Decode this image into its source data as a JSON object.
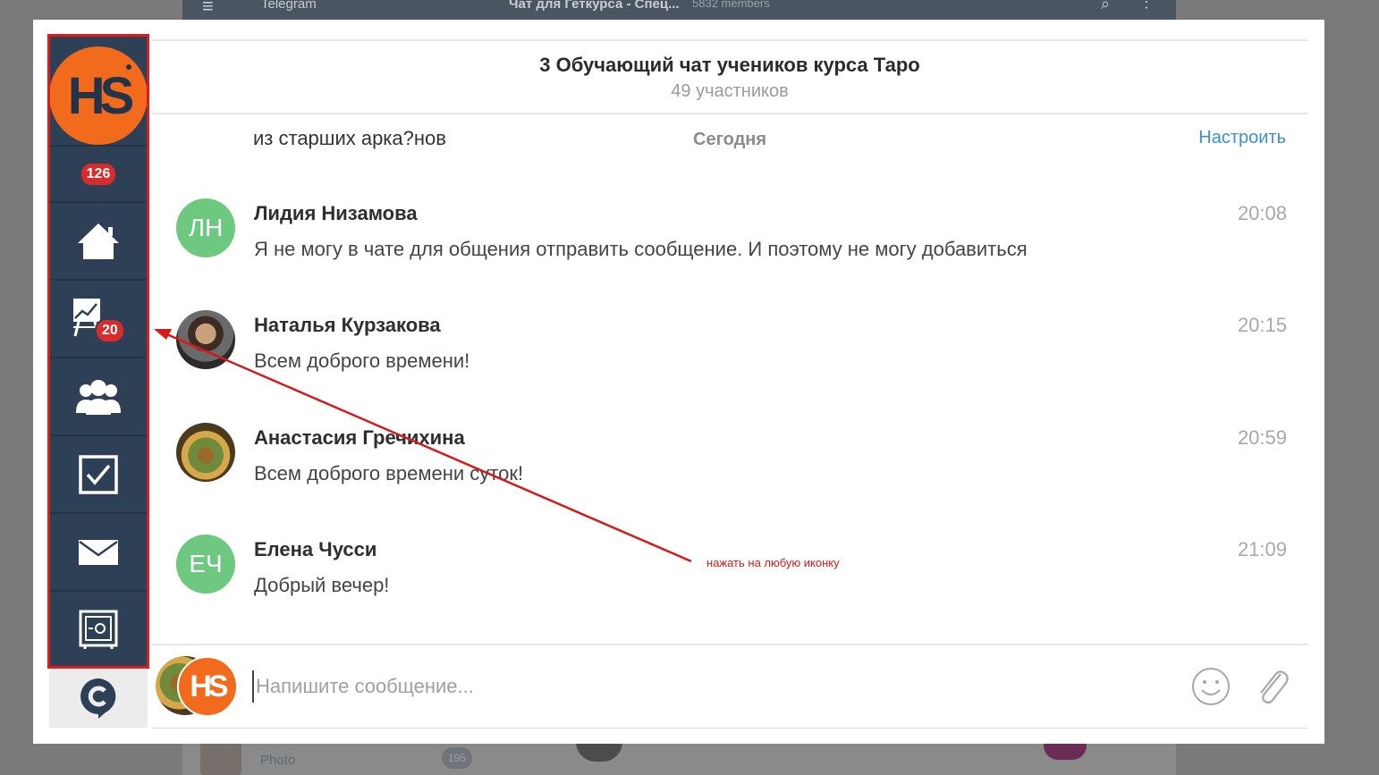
{
  "background_window": {
    "app_name": "Telegram",
    "chat_title": "Чат для Геткурса - Спец...",
    "members": "5832 members",
    "bottom_label": "Photo",
    "bottom_badge": "195"
  },
  "sidebar": {
    "logo_text": "HS",
    "notifications_badge": "126",
    "chart_badge": "20",
    "items": [
      {
        "name": "home"
      },
      {
        "name": "chart"
      },
      {
        "name": "people"
      },
      {
        "name": "tasks"
      },
      {
        "name": "mail"
      },
      {
        "name": "safe"
      }
    ],
    "bottom_icon": "chat-app-icon"
  },
  "chat": {
    "title": "3 Обучающий чат учеников курса Таро",
    "subtitle": "49 участников",
    "partial_message": "из старших арка?нов",
    "day_separator": "Сегодня",
    "settings_link": "Настроить",
    "messages": [
      {
        "initials": "ЛН",
        "name": "Лидия Низамова",
        "text": "Я не могу в чате для общения отправить сообщение. И поэтому не могу добавиться",
        "time": "20:08"
      },
      {
        "initials": "",
        "name": "Наталья Курзакова",
        "text": "Всем доброго времени!",
        "time": "20:15"
      },
      {
        "initials": "",
        "name": "Анастасия Гречихина",
        "text": "Всем доброго времени суток!",
        "time": "20:59"
      },
      {
        "initials": "ЕЧ",
        "name": "Елена Чусси",
        "text": "Добрый вечер!",
        "time": "21:09"
      }
    ]
  },
  "composer": {
    "avatar_text": "HS",
    "placeholder": "Напишите сообщение..."
  },
  "annotation": {
    "text": "нажать на любую иконку",
    "color": "#d61a1a"
  },
  "colors": {
    "sidebar_bg": "#2e4055",
    "brand_orange": "#f26a1b",
    "badge_red": "#d82c2c",
    "avatar_green": "#6dc97f",
    "link_blue": "#3a8fd1"
  }
}
